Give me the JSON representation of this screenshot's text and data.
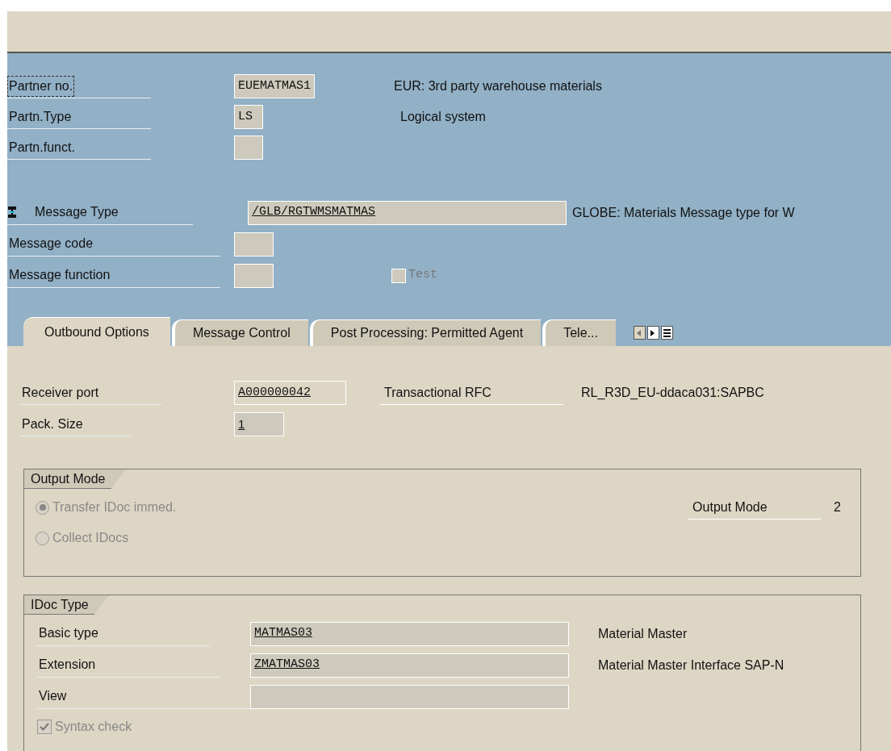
{
  "header": {
    "partner": [
      {
        "label": "Partner no.",
        "focused": true,
        "value": "EUEMATMAS1",
        "description": "EUR: 3rd party warehouse materials"
      },
      {
        "label": "Partn.Type",
        "focused": false,
        "value": "LS",
        "description": "Logical system"
      },
      {
        "label": "Partn.funct.",
        "focused": false
      }
    ],
    "message": [
      {
        "label": "Message Type",
        "kind": "wide",
        "value": "/GLB/RGTWMSMATMAS",
        "description": "GLOBE: Materials Message type for W"
      },
      {
        "label": "Message code",
        "kind": "small"
      },
      {
        "label": "Message function",
        "kind": "small"
      }
    ],
    "test": {
      "label": "Test",
      "checked": false
    }
  },
  "tabs": [
    {
      "label": "Outbound Options",
      "selected": true
    },
    {
      "label": "Message Control",
      "selected": false
    },
    {
      "label": "Post Processing: Permitted Agent",
      "selected": false
    },
    {
      "label": "Tele...",
      "selected": false
    }
  ],
  "port": {
    "label": "Receiver port",
    "value": "A000000042",
    "type": "Transactional RFC",
    "destination": "RL_R3D_EU-ddaca031:SAPBC"
  },
  "pack": {
    "label": "Pack. Size",
    "value": "1"
  },
  "output_mode": {
    "title": "Output Mode",
    "options": [
      {
        "label": "Transfer IDoc immed.",
        "selected": true
      },
      {
        "label": "Collect IDocs",
        "selected": false
      }
    ],
    "mode_label": "Output Mode",
    "mode_value": "2"
  },
  "idoc_type": {
    "title": "IDoc Type",
    "rows": [
      {
        "label": "Basic type",
        "value": "MATMAS03",
        "description": "Material Master"
      },
      {
        "label": "Extension",
        "value": "ZMATMAS03",
        "description": "Material Master Interface SAP-N"
      },
      {
        "label": "View"
      }
    ],
    "syntax_check": {
      "label": "Syntax check",
      "checked": true
    }
  }
}
